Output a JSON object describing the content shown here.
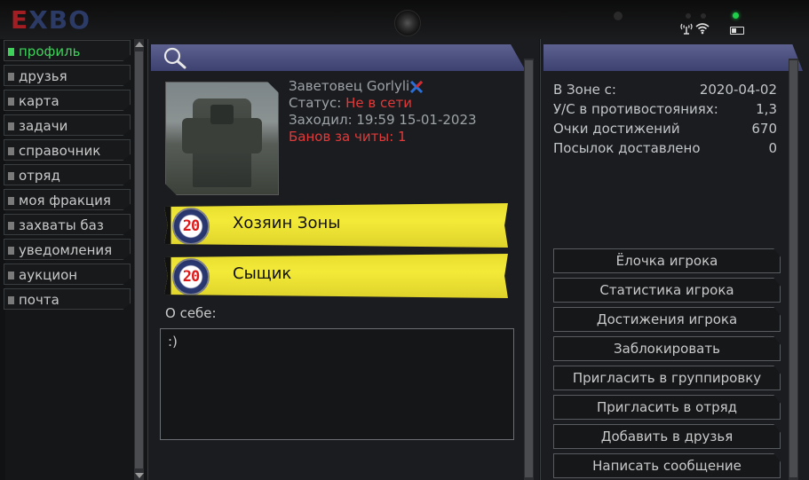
{
  "logo": {
    "e": "E",
    "x": "X",
    "bo": "BO"
  },
  "nav": {
    "items": [
      {
        "label": "профиль",
        "active": true
      },
      {
        "label": "друзья",
        "active": false
      },
      {
        "label": "карта",
        "active": false
      },
      {
        "label": "задачи",
        "active": false
      },
      {
        "label": "справочник",
        "active": false
      },
      {
        "label": "отряд",
        "active": false
      },
      {
        "label": "моя фракция",
        "active": false
      },
      {
        "label": "захваты баз",
        "active": false
      },
      {
        "label": "уведомления",
        "active": false
      },
      {
        "label": "аукцион",
        "active": false
      },
      {
        "label": "почта",
        "active": false
      }
    ]
  },
  "profile": {
    "name": "Заветовец Gorlyli",
    "status_label": "Статус: ",
    "status_value": "Не в сети",
    "last_seen": "Заходил: 19:59 15-01-2023",
    "bans": "Банов за читы: 1"
  },
  "achievements": [
    {
      "level": "20",
      "title": "Хозяин Зоны"
    },
    {
      "level": "20",
      "title": "Сыщик"
    }
  ],
  "about": {
    "label": "О себе:",
    "text": ":)"
  },
  "stats": [
    {
      "label": "В Зоне с:",
      "value": "2020-04-02"
    },
    {
      "label": "У/С в противостояниях:",
      "value": "1,3"
    },
    {
      "label": "Очки достижений",
      "value": "670"
    },
    {
      "label": "Посылок доставлено",
      "value": "0"
    }
  ],
  "actions": [
    {
      "label": "Ёлочка игрока"
    },
    {
      "label": "Статистика игрока"
    },
    {
      "label": "Достижения игрока"
    },
    {
      "label": "Заблокировать"
    },
    {
      "label": "Пригласить в группировку"
    },
    {
      "label": "Пригласить в отряд"
    },
    {
      "label": "Добавить в друзья"
    },
    {
      "label": "Написать сообщение"
    }
  ],
  "colors": {
    "active_nav": "#3fd25a",
    "alert_red": "#e23a3a",
    "achievement_yellow": "#f3ea38",
    "header_bar": "#5c6190"
  },
  "icons": [
    "search-icon",
    "antenna-icon",
    "wifi-icon",
    "battery-icon",
    "camera-icon",
    "flag-icon"
  ]
}
